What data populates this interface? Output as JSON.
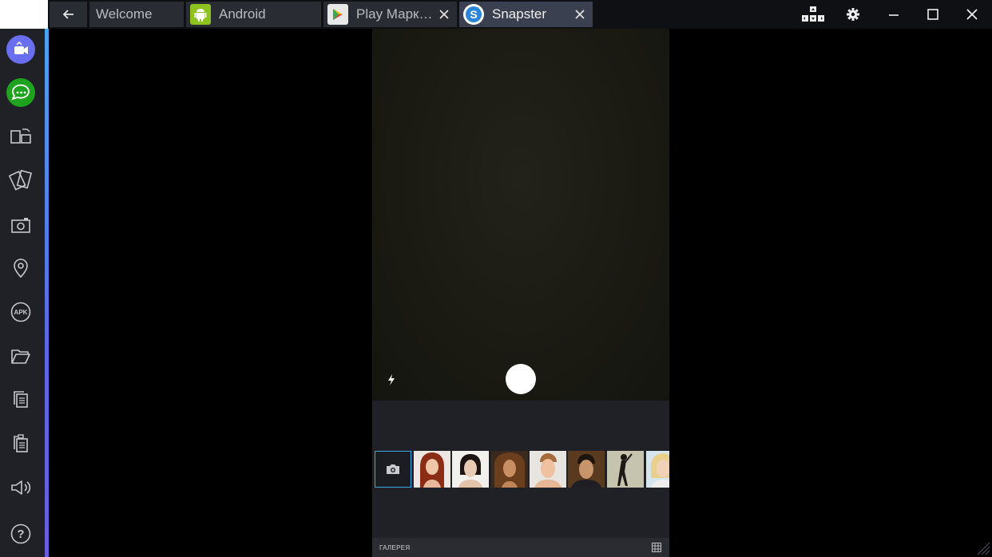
{
  "tabs": [
    {
      "label": "Welcome",
      "icon": "none"
    },
    {
      "label": "Android",
      "icon": "android-icon"
    },
    {
      "label": "Play Марк…",
      "icon": "play-store-icon"
    },
    {
      "label": "Snapster",
      "icon": "snapster-icon"
    }
  ],
  "colors": {
    "topbar": "#0f1014",
    "tab": "#2a2c33",
    "active_tab": "#3b4050",
    "sidebar": "#1f2127",
    "accent": "#5b66e6",
    "selected_thumb_border": "#3aa7e6"
  },
  "sidebar": {
    "items": [
      {
        "icon": "video-chat-icon"
      },
      {
        "icon": "messages-icon"
      },
      {
        "icon": "multi-instance-icon"
      },
      {
        "icon": "rotate-icon"
      },
      {
        "icon": "screenshot-camera-icon"
      },
      {
        "icon": "location-pin-icon"
      },
      {
        "icon": "apk-icon",
        "text": "APK"
      },
      {
        "icon": "folder-icon"
      },
      {
        "icon": "copy-icon"
      },
      {
        "icon": "paste-icon"
      },
      {
        "icon": "volume-icon"
      },
      {
        "icon": "help-icon",
        "text": "?"
      }
    ]
  },
  "app": {
    "gallery_label": "ГАЛЕРЕЯ",
    "thumbnails": [
      {
        "name": "photo-red-hair-woman"
      },
      {
        "name": "photo-asian-woman"
      },
      {
        "name": "photo-curly-hair-woman"
      },
      {
        "name": "photo-young-man"
      },
      {
        "name": "photo-dark-hair-man"
      },
      {
        "name": "photo-dancer"
      },
      {
        "name": "photo-blonde-woman"
      }
    ]
  }
}
